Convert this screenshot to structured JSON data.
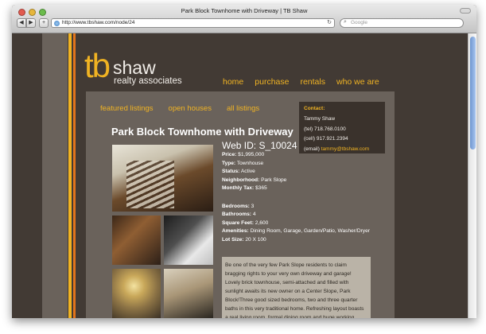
{
  "browser": {
    "window_title": "Park Block Townhome with Driveway | TB Shaw",
    "url": "http://www.tbshaw.com/node/24",
    "search_placeholder": "Google",
    "back_label": "◀",
    "forward_label": "▶",
    "add_label": "+",
    "reload_label": "↻"
  },
  "site": {
    "logo_tb": "tb",
    "logo_shaw": "shaw",
    "logo_sub": "realty associates",
    "main_nav": [
      "home",
      "purchase",
      "rentals",
      "who we are"
    ],
    "sub_nav": [
      "featured listings",
      "open houses",
      "all listings"
    ]
  },
  "contact": {
    "title": "Contact:",
    "name": "Tammy Shaw",
    "tel": "(tel) 718.768.0100",
    "cell": "(cell) 917.921.2394",
    "email_label": "(email)",
    "email": "tammy@tbshaw.com"
  },
  "listing": {
    "title": "Park Block Townhome with Driveway",
    "web_id": "Web ID: S_10024",
    "price_label": "Price:",
    "price": "$1,995,000",
    "type_label": "Type:",
    "type": "Townhouse",
    "status_label": "Status:",
    "status": "Active",
    "neighborhood_label": "Neighborhood:",
    "neighborhood": "Park Slope",
    "tax_label": "Monthly Tax:",
    "tax": "$365",
    "bedrooms_label": "Bedrooms:",
    "bedrooms": "3",
    "bathrooms_label": "Bathrooms:",
    "bathrooms": "4",
    "sqft_label": "Square Feet:",
    "sqft": "2,600",
    "amenities_label": "Amenities:",
    "amenities": "Dining Room, Garage, Garden/Patio, Washer/Dryer",
    "lot_label": "Lot Size:",
    "lot": "20 X 100",
    "description": "Be one of the very few Park Slope residents to claim bragging rights to your very own driveway and garage! Lovely brick townhouse, semi-attached and filled with sunlight awaits its new owner on a Center Slope, Park Block!Three good sized bedrooms, two and three quarter baths in this very traditional home. Refreshing layout boasts a real living room, formal dining room and huge working kitchen"
  },
  "colors": {
    "accent_yellow": "#f0b323",
    "accent_orange": "#e2741b",
    "page_bg": "#423a34",
    "panel_bg": "#6a625b"
  }
}
